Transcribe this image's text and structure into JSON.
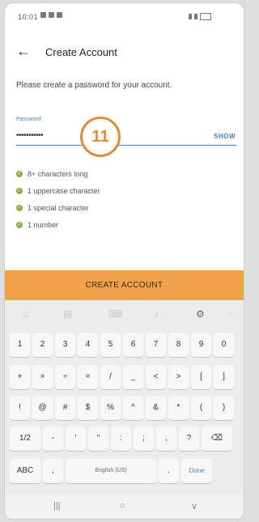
{
  "status_bar": {
    "time": "10:01"
  },
  "app_bar": {
    "back": "←",
    "title": "Create Account"
  },
  "prompt": "Please create a password for your account.",
  "password": {
    "label": "Password",
    "value": "•••••••••••",
    "show_label": "SHOW"
  },
  "badge": "11",
  "requirements": [
    "8+ characters long",
    "1 uppercase character",
    "1 special character",
    "1 number"
  ],
  "create_button": "CREATE ACCOUNT",
  "keyboard": {
    "tools": [
      "☺",
      "▤",
      "⌨",
      "♪",
      "⚙",
      "⋯"
    ],
    "rows": [
      [
        "1",
        "2",
        "3",
        "4",
        "5",
        "6",
        "7",
        "8",
        "9",
        "0"
      ],
      [
        "+",
        "×",
        "÷",
        "=",
        "/",
        "_",
        "<",
        ">",
        "[",
        "]"
      ],
      [
        "!",
        "@",
        "#",
        "$",
        "%",
        "^",
        "&",
        "*",
        "(",
        ")"
      ],
      [
        "1/2",
        "-",
        "'",
        "\"",
        ":",
        ";",
        ",",
        "?",
        "⌫"
      ],
      [
        "ABC",
        ",",
        "English (US)",
        ".",
        "Done"
      ]
    ]
  },
  "nav": [
    "|||",
    "○",
    "∨"
  ]
}
